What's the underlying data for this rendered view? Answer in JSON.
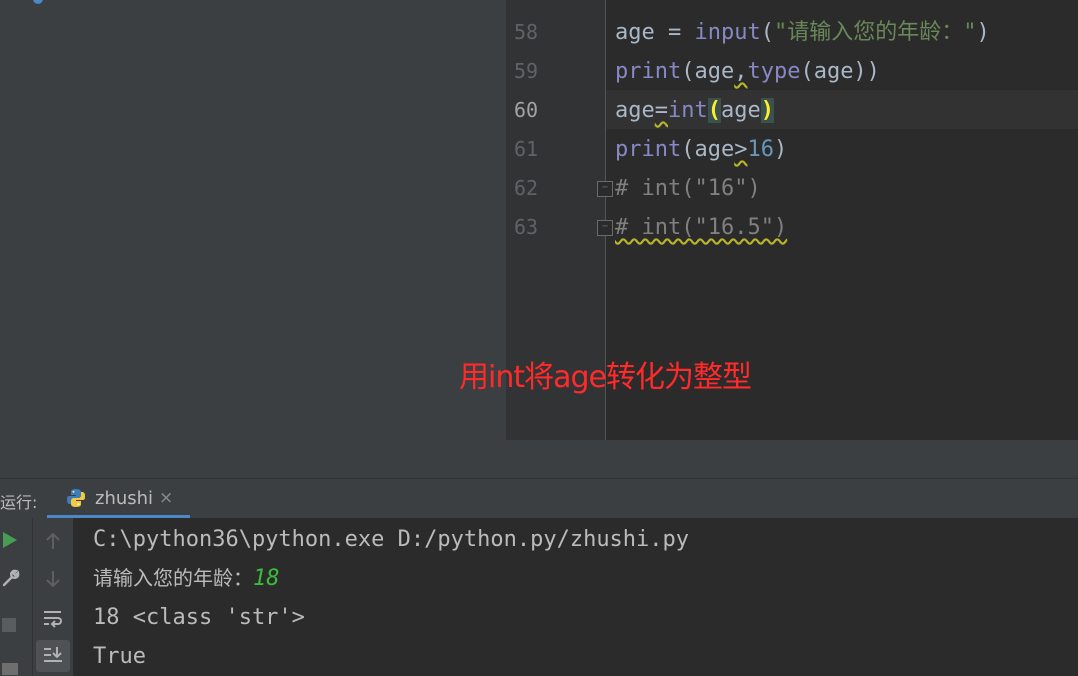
{
  "editor": {
    "lines": [
      {
        "num": "58",
        "active": false,
        "tokens": [
          {
            "t": "age = ",
            "c": ""
          },
          {
            "t": "input",
            "c": "kw"
          },
          {
            "t": "(",
            "c": ""
          },
          {
            "t": "\"请输入您的年龄：\"",
            "c": "str"
          },
          {
            "t": ")",
            "c": ""
          }
        ]
      },
      {
        "num": "59",
        "active": false,
        "tokens": [
          {
            "t": "print",
            "c": "kw"
          },
          {
            "t": "(age",
            "c": ""
          },
          {
            "t": ",",
            "c": "squig"
          },
          {
            "t": "type",
            "c": "kw"
          },
          {
            "t": "(age))",
            "c": ""
          }
        ]
      },
      {
        "num": "60",
        "active": true,
        "tokens": [
          {
            "t": "age",
            "c": ""
          },
          {
            "t": "=",
            "c": "squig"
          },
          {
            "t": "int",
            "c": "kw"
          },
          {
            "t": "(",
            "c": "paren-hl"
          },
          {
            "t": "age",
            "c": ""
          },
          {
            "t": ")",
            "c": "paren-hl"
          }
        ]
      },
      {
        "num": "61",
        "active": false,
        "tokens": [
          {
            "t": "print",
            "c": "kw"
          },
          {
            "t": "(age",
            "c": ""
          },
          {
            "t": ">",
            "c": "squig"
          },
          {
            "t": "16",
            "c": "num"
          },
          {
            "t": ")",
            "c": ""
          }
        ]
      },
      {
        "num": "62",
        "active": false,
        "tokens": [
          {
            "t": "# int(\"16\")",
            "c": "cmt"
          }
        ]
      },
      {
        "num": "63",
        "active": false,
        "tokens": [
          {
            "t": "# int(\"16.5\")",
            "c": "cmt squig"
          }
        ]
      }
    ]
  },
  "annotation": {
    "text": "用int将age转化为整型",
    "color": "#ff2a2a"
  },
  "run_panel": {
    "label": "运行:",
    "tab": {
      "label": "zhushi",
      "close": "×",
      "icon": "python-icon"
    },
    "console": {
      "command": "C:\\python36\\python.exe D:/python.py/zhushi.py",
      "prompt": "请输入您的年龄：",
      "user_input": "18",
      "output1": "18 <class 'str'>",
      "output2": "True"
    }
  },
  "colors": {
    "accent": "#4a88c7",
    "keyword": "#8888c6",
    "string": "#6a8759",
    "number": "#6897bb",
    "comment": "#808080",
    "input": "#3bbb3b"
  }
}
